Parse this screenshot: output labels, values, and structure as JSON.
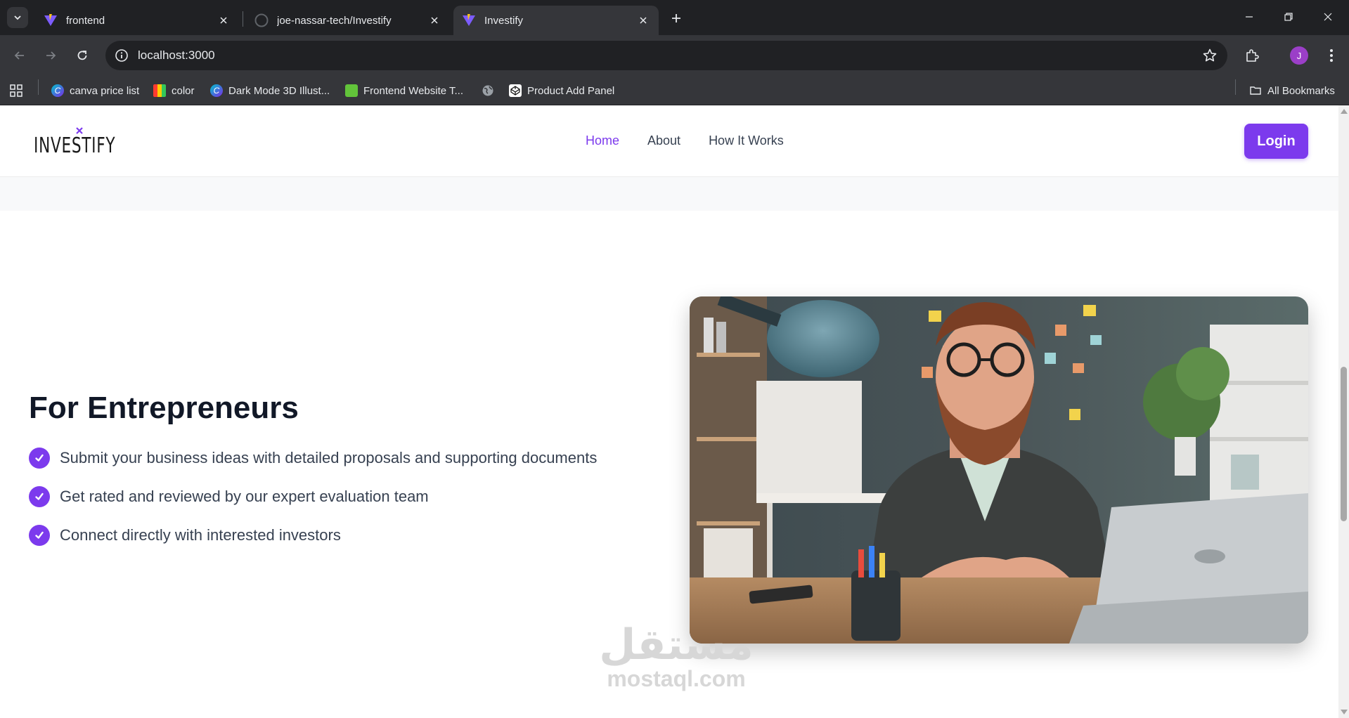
{
  "browser": {
    "tabs": [
      {
        "title": "frontend",
        "active": false
      },
      {
        "title": "joe-nassar-tech/Investify",
        "active": false
      },
      {
        "title": "Investify",
        "active": true
      }
    ],
    "url": "localhost:3000",
    "profile_initial": "J",
    "bookmarks": [
      {
        "label": "canva price list",
        "icon": "canva-icon"
      },
      {
        "label": "color",
        "icon": "color-grid-icon"
      },
      {
        "label": "Dark Mode 3D Illust...",
        "icon": "canva-icon"
      },
      {
        "label": "Frontend Website T...",
        "icon": "frontend-bookmark-icon"
      },
      {
        "label": "",
        "icon": "globe-icon"
      },
      {
        "label": "Product Add Panel",
        "icon": "codepen-icon"
      }
    ],
    "all_bookmarks_label": "All Bookmarks"
  },
  "site": {
    "logo_text": "INVESTIFY",
    "nav": [
      {
        "label": "Home",
        "active": true
      },
      {
        "label": "About",
        "active": false
      },
      {
        "label": "How It Works",
        "active": false
      }
    ],
    "login_label": "Login",
    "accent_color": "#7c3aed"
  },
  "section": {
    "heading": "For Entrepreneurs",
    "features": [
      "Submit your business ideas with detailed proposals and supporting documents",
      "Get rated and reviewed by our expert evaluation team",
      "Connect directly with interested investors"
    ]
  },
  "watermark": {
    "arabic": "مستقل",
    "latin": "mostaql.com"
  }
}
